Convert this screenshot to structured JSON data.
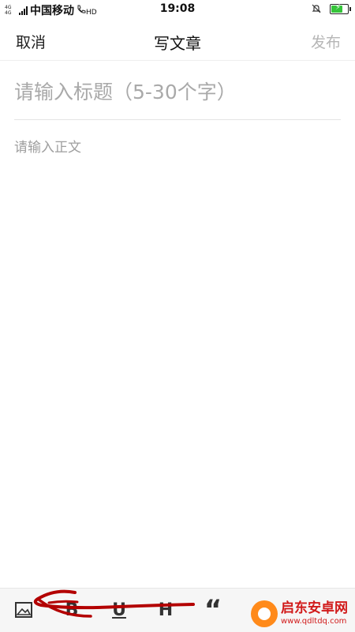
{
  "status_bar": {
    "network_type": "4G 4G",
    "carrier": "中国移动",
    "hd_label": "HD",
    "time": "19:08",
    "battery_level": 0.7
  },
  "header": {
    "cancel_label": "取消",
    "title": "写文章",
    "publish_label": "发布"
  },
  "editor": {
    "title_placeholder": "请输入标题（5-30个字）",
    "body_placeholder": "请输入正文"
  },
  "toolbar": {
    "tools": [
      {
        "name": "image-icon"
      },
      {
        "name": "bold-icon",
        "glyph": "B"
      },
      {
        "name": "underline-icon",
        "glyph": "U"
      },
      {
        "name": "heading-icon",
        "glyph": "H"
      },
      {
        "name": "quote-icon",
        "glyph": "“"
      },
      {
        "name": "more-icon",
        "glyph": "⌄"
      }
    ]
  },
  "watermark": {
    "name": "启东安卓网",
    "url": "www.qdltdq.com"
  },
  "colors": {
    "publish_disabled": "#b6b6b6",
    "placeholder": "#a9a9a9",
    "battery": "#35c43a",
    "annotation": "#b30000"
  }
}
